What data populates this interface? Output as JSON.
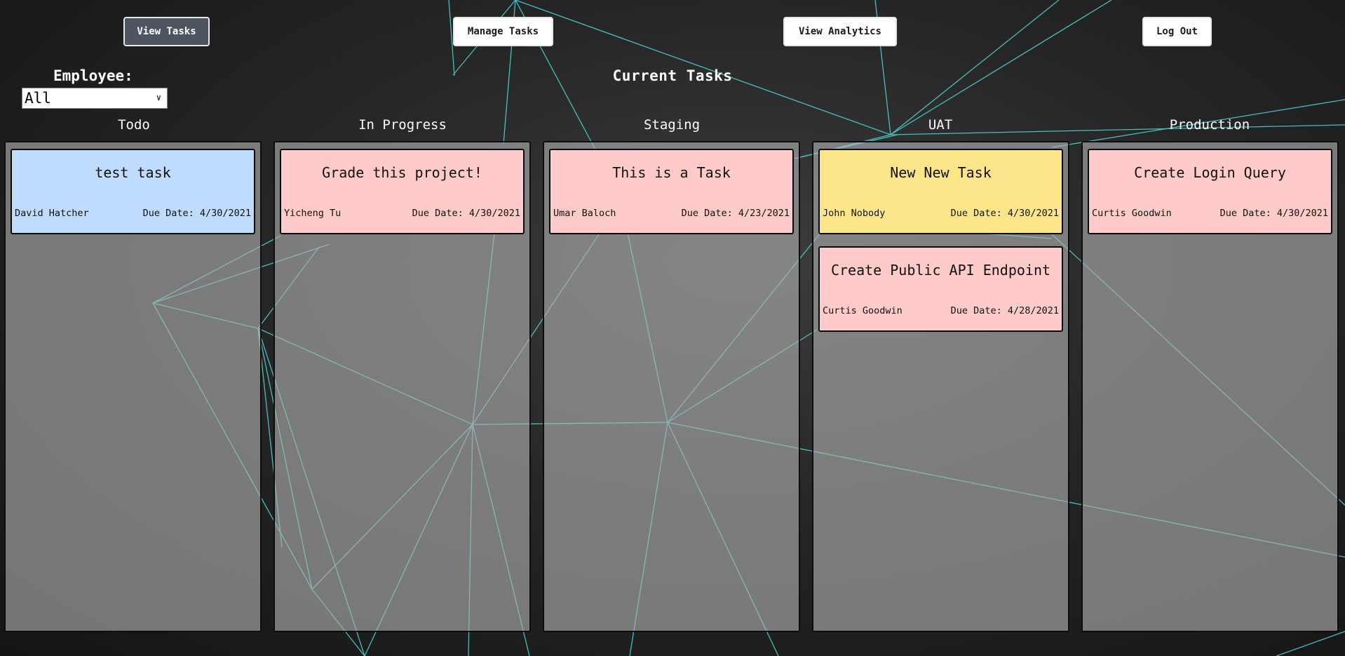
{
  "nav": {
    "view_tasks": "View Tasks",
    "manage_tasks": "Manage Tasks",
    "view_analytics": "View Analytics",
    "log_out": "Log Out"
  },
  "filter": {
    "label": "Employee:",
    "selected": "All"
  },
  "board": {
    "title": "Current Tasks",
    "columns": [
      {
        "name": "Todo",
        "cards": [
          {
            "title": "test task",
            "assignee": "David Hatcher",
            "due": "Due Date: 4/30/2021",
            "color": "#bfdbfe"
          }
        ]
      },
      {
        "name": "In Progress",
        "cards": [
          {
            "title": "Grade this project!",
            "assignee": "Yicheng Tu",
            "due": "Due Date: 4/30/2021",
            "color": "#fecaca"
          }
        ]
      },
      {
        "name": "Staging",
        "cards": [
          {
            "title": "This is a Task",
            "assignee": "Umar Baloch",
            "due": "Due Date: 4/23/2021",
            "color": "#fecaca"
          }
        ]
      },
      {
        "name": "UAT",
        "cards": [
          {
            "title": "New New Task",
            "assignee": "John Nobody",
            "due": "Due Date: 4/30/2021",
            "color": "#fde68a"
          },
          {
            "title": "Create Public API Endpoint",
            "assignee": "Curtis Goodwin",
            "due": "Due Date: 4/28/2021",
            "color": "#fecaca"
          }
        ]
      },
      {
        "name": "Production",
        "cards": [
          {
            "title": "Create Login Query",
            "assignee": "Curtis Goodwin",
            "due": "Due Date: 4/30/2021",
            "color": "#fecaca"
          }
        ]
      }
    ]
  },
  "colors": {
    "background_line": "#4fd8d8",
    "active_nav": "#4d5561"
  }
}
